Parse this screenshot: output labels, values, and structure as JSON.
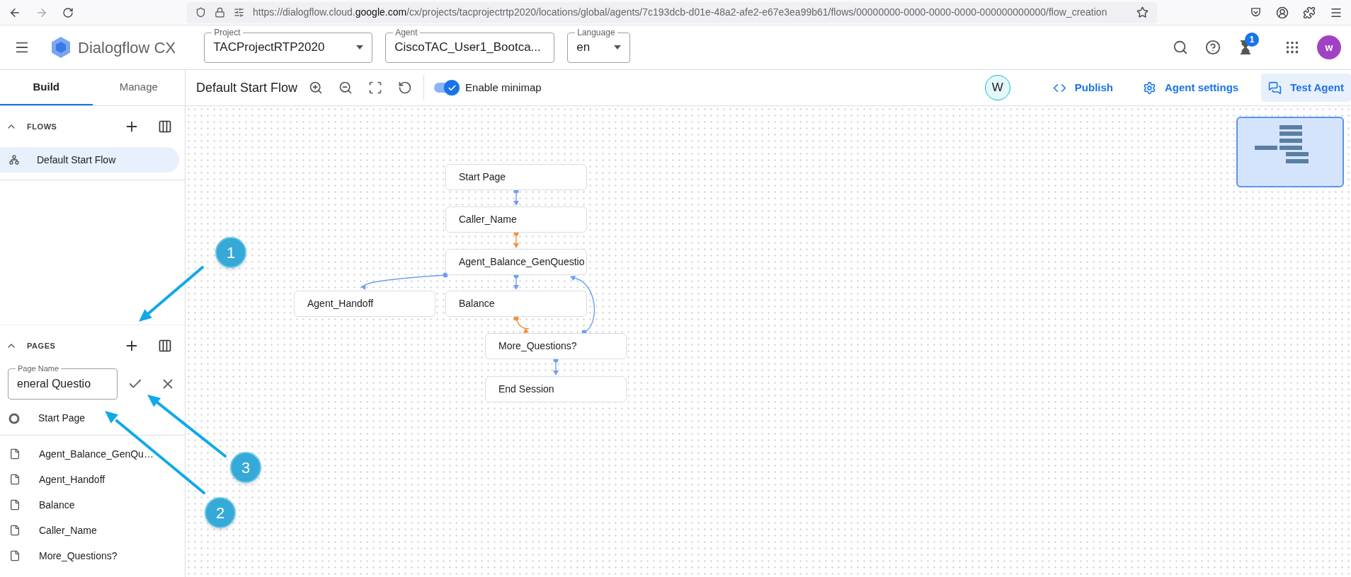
{
  "browser": {
    "url_prefix": "https://dialogflow.cloud.",
    "url_domain": "google.com",
    "url_path": "/cx/projects/tacprojectrtp2020/locations/global/agents/7c193dcb-d01e-48a2-afe2-e67e3ea99b61/flows/00000000-0000-0000-0000-000000000000/flow_creation"
  },
  "header": {
    "product": "Dialogflow CX",
    "selects": [
      {
        "label": "Project",
        "value": "TACProjectRTP2020"
      },
      {
        "label": "Agent",
        "value": "CiscoTAC_User1_Bootca..."
      },
      {
        "label": "Language",
        "value": "en"
      }
    ],
    "notification_count": "1",
    "avatar": "w"
  },
  "tabs": [
    {
      "label": "Build",
      "selected": true
    },
    {
      "label": "Manage",
      "selected": false
    }
  ],
  "toolbar": {
    "flow_title": "Default Start Flow",
    "minimap": {
      "label": "Enable minimap",
      "on": true
    },
    "reviewer": "W",
    "actions": [
      {
        "label": "Publish",
        "kind": "code",
        "active": false
      },
      {
        "label": "Agent settings",
        "kind": "settings",
        "active": false
      },
      {
        "label": "Test Agent",
        "kind": "chat",
        "active": true
      }
    ]
  },
  "flows": {
    "title": "FLOWS",
    "items": [
      {
        "label": "Default Start Flow",
        "selected": true
      }
    ]
  },
  "pages": {
    "title": "PAGES",
    "page_name_field": {
      "label": "Page Name",
      "value": "eneral Questio"
    },
    "start_page": "Start Page",
    "items": [
      "Agent_Balance_GenQu…",
      "Agent_Handoff",
      "Balance",
      "Caller_Name",
      "More_Questions?"
    ]
  },
  "diagram": {
    "nodes": [
      "Start Page",
      "Caller_Name",
      "Agent_Balance_GenQuestio",
      "Agent_Handoff",
      "Balance",
      "More_Questions?",
      "End Session"
    ],
    "edges": [
      {
        "color": "#6f9ef5"
      },
      {
        "color": "#f39040"
      },
      {
        "color": "#6f9ef5"
      },
      {
        "color": "#6f9ef5"
      },
      {
        "color": "#f39040"
      },
      {
        "color": "#6f9ef5"
      },
      {
        "color": "#6f9ef5"
      }
    ]
  },
  "annotations": [
    {
      "label": "1"
    },
    {
      "label": "2"
    },
    {
      "label": "3"
    }
  ]
}
